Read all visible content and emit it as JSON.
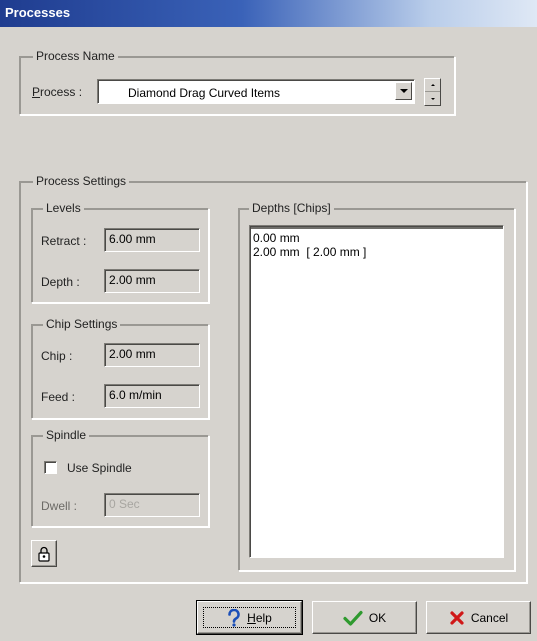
{
  "window": {
    "title": "Processes"
  },
  "process_name_group": {
    "legend": "Process Name",
    "process_label_hotkey": "P",
    "process_label_rest": "rocess :",
    "selected_value": "Diamond Drag Curved Items"
  },
  "process_settings_group": {
    "legend": "Process Settings"
  },
  "levels": {
    "legend": "Levels",
    "retract_label": "Retract :",
    "retract_value": "6.00 mm",
    "depth_label": "Depth :",
    "depth_value": "2.00 mm"
  },
  "chip_settings": {
    "legend": "Chip Settings",
    "chip_label": "Chip :",
    "chip_value": "2.00 mm",
    "feed_label": "Feed :",
    "feed_value": "6.0 m/min"
  },
  "spindle": {
    "legend": "Spindle",
    "use_spindle_label": "Use Spindle",
    "use_spindle_checked": false,
    "dwell_label": "Dwell :",
    "dwell_value": "0 Sec"
  },
  "depths": {
    "legend": "Depths [Chips]",
    "items": [
      "0.00 mm",
      "2.00 mm  [ 2.00 mm ]"
    ]
  },
  "buttons": {
    "help_hotkey": "H",
    "help_rest": "elp",
    "ok": "OK",
    "cancel": "Cancel"
  },
  "icons": {
    "lock": "lock-icon",
    "help": "question-mark-icon",
    "ok": "checkmark-icon",
    "cancel": "x-icon"
  },
  "colors": {
    "title_start": "#1f3c8f",
    "title_end": "#dfe8f5",
    "face": "#d6d3ce",
    "ok_green": "#2f9a2f",
    "cancel_red": "#d01818",
    "help_blue": "#1b4fb8"
  }
}
